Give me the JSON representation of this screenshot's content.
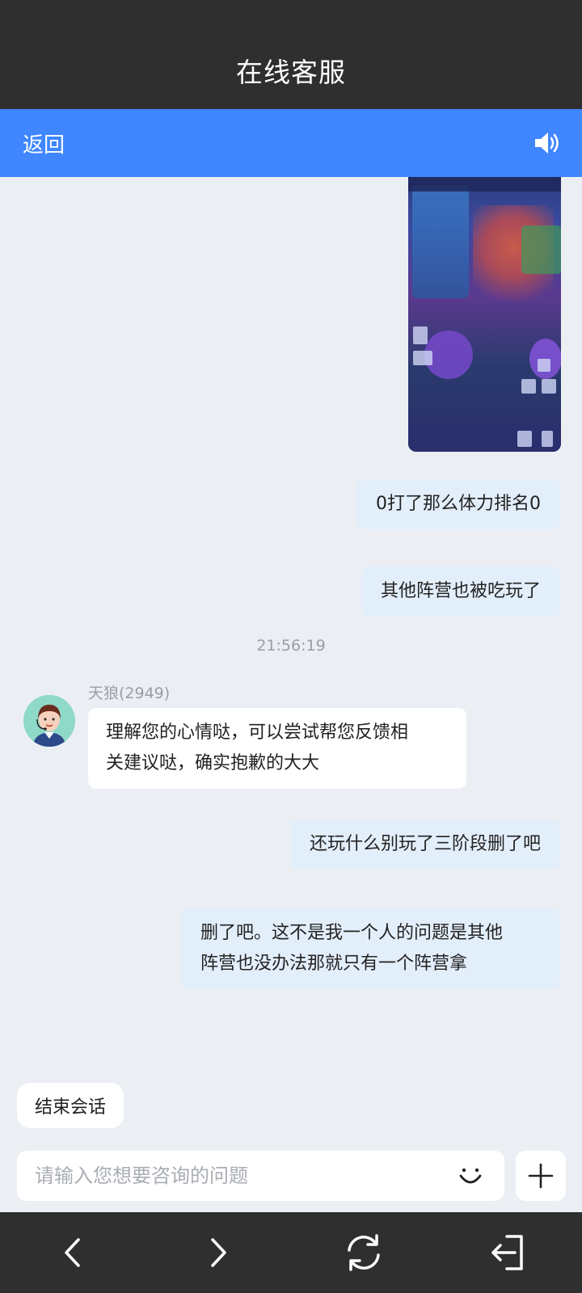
{
  "header": {
    "title": "在线客服"
  },
  "navbar": {
    "back_label": "返回"
  },
  "messages": {
    "user_1": "0打了那么体力排名0",
    "user_2": "其他阵营也被吃玩了",
    "timestamp": "21:56:19",
    "agent_name": "天狼(2949)",
    "agent_1_line1": "理解您的心情哒，可以尝试帮您反馈相",
    "agent_1_line2": "关建议哒，确实抱歉的大大",
    "user_3": "还玩什么别玩了三阶段删了吧",
    "user_4_line1": "删了吧。这不是我一个人的问题是其他",
    "user_4_line2": "阵营也没办法那就只有一个阵营拿"
  },
  "composer": {
    "end_label": "结束会话",
    "placeholder": "请输入您想要咨询的问题"
  },
  "icons": {
    "speaker": "speaker-icon",
    "emoji": "smile-icon",
    "plus": "plus-icon",
    "back": "chevron-left-icon",
    "forward": "chevron-right-icon",
    "refresh": "refresh-icon",
    "exit": "exit-icon"
  },
  "colors": {
    "title_bg": "#2f2f2f",
    "navbar_bg": "#3f86ff",
    "chat_bg": "#ebeff4",
    "user_bubble": "#e3eefb",
    "agent_bubble": "#ffffff"
  }
}
